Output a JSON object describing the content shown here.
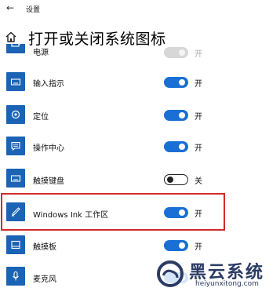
{
  "window": {
    "title": "设置"
  },
  "header": {
    "title": "打开或关闭系统图标"
  },
  "items": [
    {
      "label": "电源",
      "state": "开",
      "icon": "battery-icon",
      "toggle": "on-disabled"
    },
    {
      "label": "输入指示",
      "state": "开",
      "icon": "keyboard-icon",
      "toggle": "on"
    },
    {
      "label": "定位",
      "state": "开",
      "icon": "location-icon",
      "toggle": "on"
    },
    {
      "label": "操作中心",
      "state": "开",
      "icon": "action-center-icon",
      "toggle": "on"
    },
    {
      "label": "触摸键盘",
      "state": "关",
      "icon": "touch-keyboard-icon",
      "toggle": "off"
    },
    {
      "label": "Windows Ink 工作区",
      "state": "开",
      "icon": "pen-icon",
      "toggle": "on"
    },
    {
      "label": "触摸板",
      "state": "开",
      "icon": "touchpad-icon",
      "toggle": "on"
    },
    {
      "label": "麦克风",
      "state": "开",
      "icon": "microphone-icon",
      "toggle": "on"
    }
  ],
  "watermark": {
    "name": "黑云系统",
    "url": "heiyunxitong.com"
  },
  "colors": {
    "accent": "#1a6fd6",
    "tile": "#1b63b5",
    "highlight": "#d12a2a",
    "watermark": "#2b3b63"
  }
}
